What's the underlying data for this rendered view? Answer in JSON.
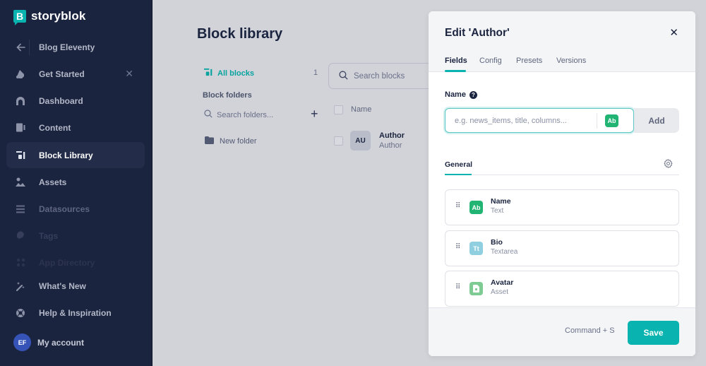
{
  "app": {
    "brand": "storyblok",
    "brand_color": "#09b3af"
  },
  "sidebar": {
    "back": {
      "label": "Blog Eleventy",
      "icon": "arrow-left-icon"
    },
    "items": [
      {
        "label": "Get Started",
        "icon": "wave-hand-icon",
        "closable": true
      },
      {
        "label": "Dashboard",
        "icon": "dashboard-icon"
      },
      {
        "label": "Content",
        "icon": "content-icon"
      },
      {
        "label": "Block Library",
        "icon": "block-library-icon",
        "active": true
      },
      {
        "label": "Assets",
        "icon": "assets-icon"
      },
      {
        "label": "Datasources",
        "icon": "datasources-icon"
      },
      {
        "label": "Tags",
        "icon": "tag-icon"
      },
      {
        "label": "App Directory",
        "icon": "app-directory-icon"
      },
      {
        "label": "What's New",
        "icon": "magic-wand-icon"
      },
      {
        "label": "Help & Inspiration",
        "icon": "lifebuoy-icon"
      }
    ],
    "account": {
      "initials": "EF",
      "label": "My account"
    }
  },
  "main": {
    "title": "Block library",
    "all_blocks": {
      "label": "All blocks",
      "count": "1"
    },
    "folders_heading": "Block folders",
    "folder_search_placeholder": "Search folders...",
    "folders": [
      {
        "label": "New folder"
      }
    ],
    "block_search_placeholder": "Search blocks",
    "table": {
      "columns": [
        "Name"
      ],
      "rows": [
        {
          "badge": "AU",
          "name": "Author",
          "technical_name": "Author"
        }
      ]
    }
  },
  "modal": {
    "title": "Edit 'Author'",
    "tabs": [
      "Fields",
      "Config",
      "Presets",
      "Versions"
    ],
    "active_tab": "Fields",
    "name_label": "Name",
    "name_input": {
      "value": "",
      "placeholder": "e.g. news_items, title, columns..."
    },
    "type_badge": "Ab",
    "add_label": "Add",
    "group_tab": "General",
    "fields": [
      {
        "name": "Name",
        "type": "Text",
        "badge": "Ab",
        "color": "#22b473"
      },
      {
        "name": "Bio",
        "type": "Textarea",
        "badge": "Tt",
        "color": "#8fcfe0"
      },
      {
        "name": "Avatar",
        "type": "Asset",
        "badge": "",
        "color": "#7ecb94"
      }
    ],
    "shortcut": "Command + S",
    "save_label": "Save"
  }
}
